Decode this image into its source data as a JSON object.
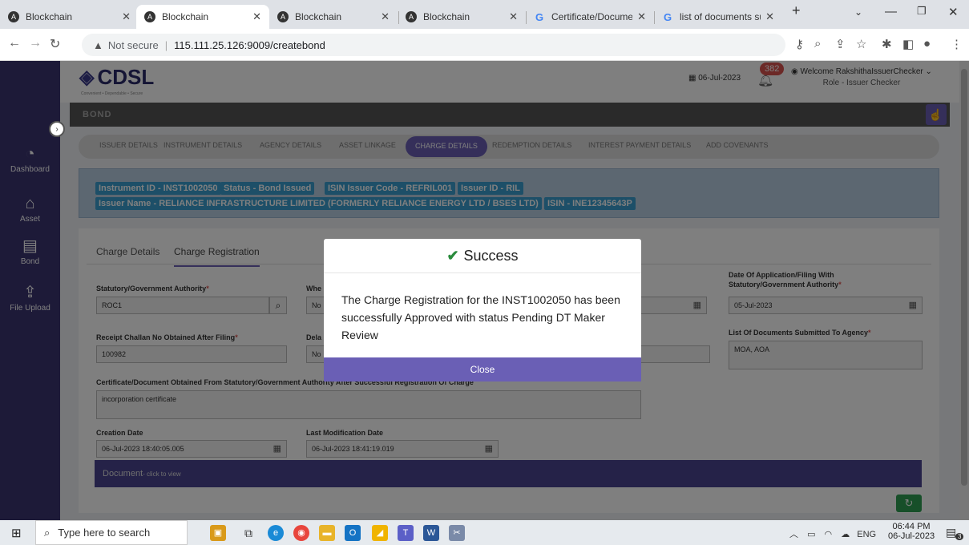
{
  "browser": {
    "tabs": [
      {
        "title": "Blockchain",
        "active": false
      },
      {
        "title": "Blockchain",
        "active": true
      },
      {
        "title": "Blockchain",
        "active": false
      },
      {
        "title": "Blockchain",
        "active": false
      },
      {
        "title": "Certificate/Document",
        "active": false
      },
      {
        "title": "list of documents sub",
        "active": false
      }
    ],
    "not_secure": "Not secure",
    "url": "115.111.25.126:9009/createbond"
  },
  "sidebar": {
    "items": [
      {
        "label": "Dashboard",
        "icon": "dashboard-icon"
      },
      {
        "label": "Asset",
        "icon": "home-icon"
      },
      {
        "label": "Bond",
        "icon": "bond-icon"
      },
      {
        "label": "File Upload",
        "icon": "upload-icon"
      }
    ]
  },
  "header": {
    "logo": "CDSL",
    "tagline": "Convenient • Dependable • Secure",
    "date": "06-Jul-2023",
    "notifications": "382",
    "welcome": "Welcome RakshithaIssuerChecker",
    "role": "Role - Issuer Checker"
  },
  "bond_bar": "BOND",
  "nav_tabs": [
    "ISSUER DETAILS",
    "INSTRUMENT DETAILS",
    "AGENCY DETAILS",
    "ASSET LINKAGE",
    "CHARGE DETAILS",
    "REDEMPTION DETAILS",
    "INTEREST PAYMENT DETAILS",
    "ADD COVENANTS"
  ],
  "info": {
    "instrument_id": "Instrument ID - INST1002050",
    "status": "Status - Bond Issued",
    "isin_issuer_code": "ISIN Issuer Code - REFRIL001",
    "issuer_id": "Issuer ID - RIL",
    "issuer_name": "Issuer Name - RELIANCE INFRASTRUCTURE LIMITED (FORMERLY RELIANCE ENERGY LTD / BSES LTD)",
    "isin": "ISIN - INE12345643P"
  },
  "sub_tabs": [
    "Charge Details",
    "Charge Registration"
  ],
  "form": {
    "statutory_label": "Statutory/Government Authority",
    "statutory_value": "ROC1",
    "whe_label": "Whe",
    "whe_value": "No",
    "date_app_label_1": "Date Of Application/Filing With",
    "date_app_label_2": "Statutory/Government Authority",
    "date_app_value": "05-Jul-2023",
    "receipt_label": "Receipt Challan No Obtained After Filing",
    "receipt_value": "100982",
    "dela_label": "Dela",
    "dela_value": "No",
    "docs_label": "List Of Documents Submitted To Agency",
    "docs_value": "MOA, AOA",
    "cert_label": "Certificate/Document Obtained From Statutory/Government Authority After Successful Registration Of Charge",
    "cert_value": "incorporation certificate",
    "creation_label": "Creation Date",
    "creation_value": "06-Jul-2023 18:40:05.005",
    "lastmod_label": "Last Modification Date",
    "lastmod_value": "06-Jul-2023 18:41:19.019",
    "document_bar": "Document",
    "document_hint": "- click to view"
  },
  "modal": {
    "title": "Success",
    "message": "The Charge Registration for the INST1002050 has been successfully Approved with status Pending DT Maker Review",
    "close": "Close"
  },
  "taskbar": {
    "search_placeholder": "Type here to search",
    "lang": "ENG",
    "time": "06:44 PM",
    "date": "06-Jul-2023",
    "notif_count": "3"
  }
}
